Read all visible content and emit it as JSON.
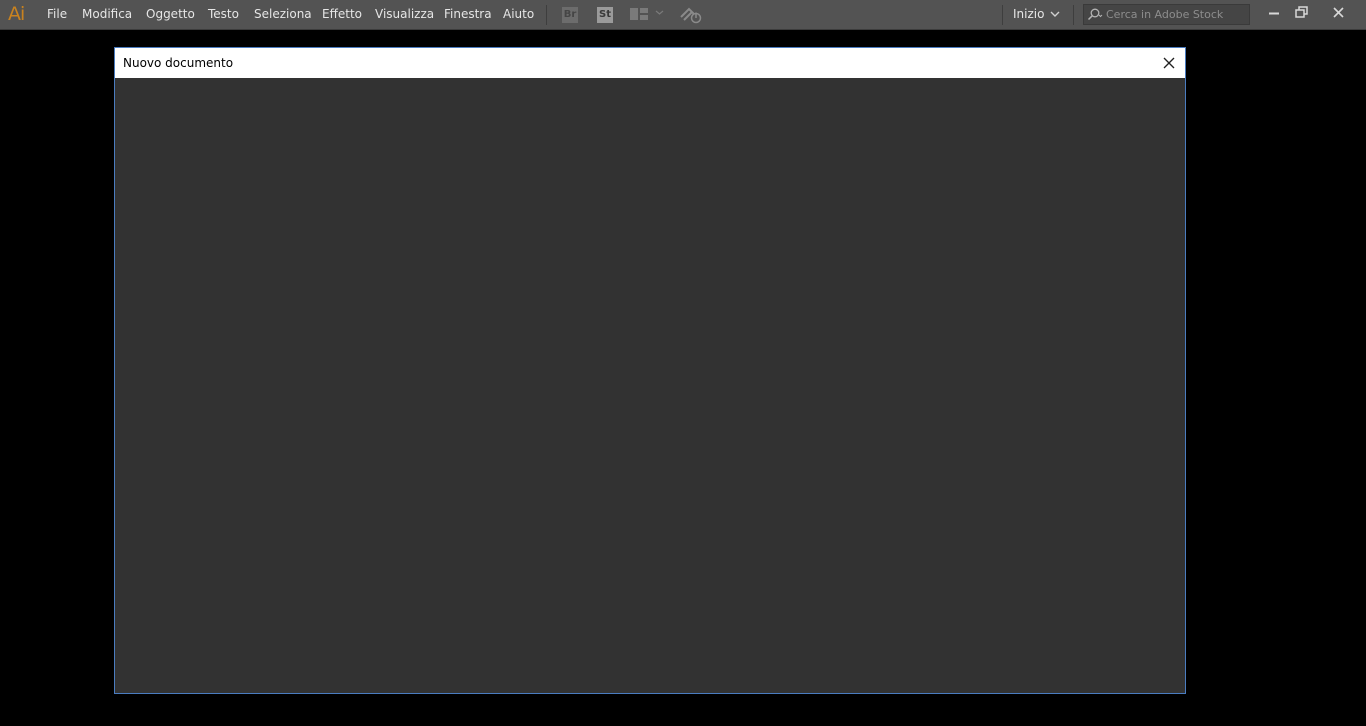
{
  "app": {
    "logo_text": "Ai",
    "brand_color": "#c8821f"
  },
  "menu": {
    "items": [
      "File",
      "Modifica",
      "Oggetto",
      "Testo",
      "Seleziona",
      "Effetto",
      "Visualizza",
      "Finestra",
      "Aiuto"
    ]
  },
  "toolbar": {
    "bridge_label": "Br",
    "stock_label": "St",
    "icons": [
      "bridge-icon",
      "stock-icon",
      "arrange-documents-icon",
      "chevron-down-icon",
      "gpu-performance-icon"
    ]
  },
  "workspace": {
    "label": "Inizio"
  },
  "search": {
    "placeholder": "Cerca in Adobe Stock",
    "value": ""
  },
  "window_controls": {
    "icons": [
      "minimize-icon",
      "restore-icon",
      "close-icon"
    ]
  },
  "dialog": {
    "title": "Nuovo documento",
    "border_color": "#4a7cc0",
    "body_color": "#323232"
  }
}
